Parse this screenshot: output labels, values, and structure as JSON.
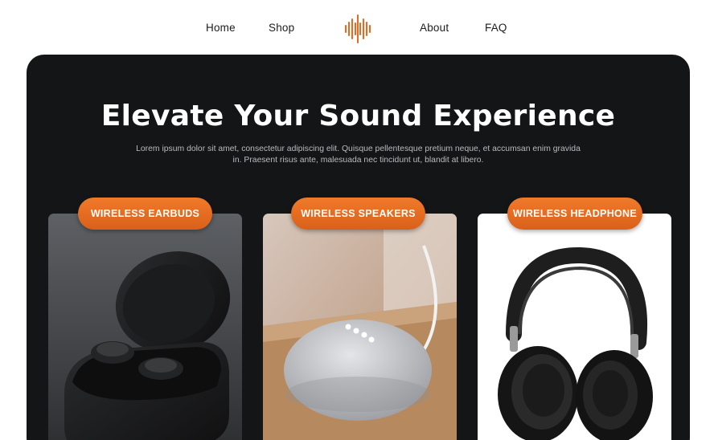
{
  "nav": {
    "home": "Home",
    "shop": "Shop",
    "about": "About",
    "faq": "FAQ",
    "logo_icon": "sound-wave-icon"
  },
  "hero": {
    "title": "Elevate Your Sound Experience",
    "description": "Lorem ipsum dolor sit amet, consectetur adipiscing elit. Quisque pellentesque pretium neque, et accumsan enim gravida in. Praesent risus ante, malesuada nec tincidunt ut, blandit at libero."
  },
  "products": [
    {
      "label": "WIRELESS EARBUDS",
      "image": "earbuds-image"
    },
    {
      "label": "WIRELESS SPEAKERS",
      "image": "smart-speaker-image"
    },
    {
      "label": "WIRELESS HEADPHONE",
      "image": "headphones-image"
    }
  ],
  "colors": {
    "accent": "#e8691f",
    "hero_background": "#141517",
    "page_background": "#ffffff"
  }
}
